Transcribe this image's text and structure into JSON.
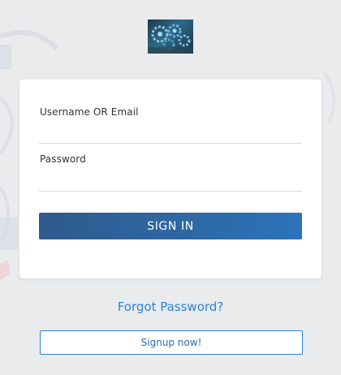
{
  "logo": {
    "icon": "gears-logo-icon"
  },
  "login_form": {
    "username_label": "Username OR Email",
    "username_value": "",
    "password_label": "Password",
    "password_value": "",
    "signin_label": "SIGN IN"
  },
  "forgot_password_label": "Forgot Password?",
  "signup_label": "Signup now!",
  "colors": {
    "background": "#eaebed",
    "primary_button_start": "#2f5a8c",
    "primary_button_end": "#2b73b9",
    "link": "#2b82d9"
  }
}
